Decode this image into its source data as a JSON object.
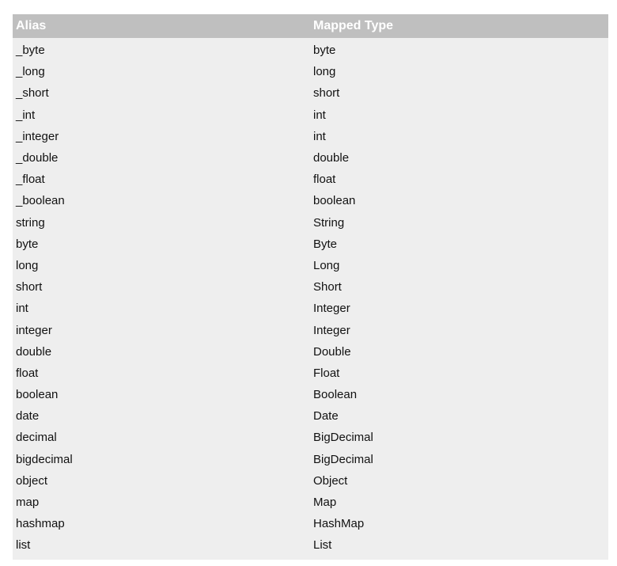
{
  "table": {
    "headers": {
      "alias": "Alias",
      "mapped_type": "Mapped Type"
    },
    "rows": [
      {
        "alias": "_byte",
        "mapped_type": "byte"
      },
      {
        "alias": "_long",
        "mapped_type": "long"
      },
      {
        "alias": "_short",
        "mapped_type": "short"
      },
      {
        "alias": "_int",
        "mapped_type": "int"
      },
      {
        "alias": "_integer",
        "mapped_type": "int"
      },
      {
        "alias": "_double",
        "mapped_type": "double"
      },
      {
        "alias": "_float",
        "mapped_type": "float"
      },
      {
        "alias": "_boolean",
        "mapped_type": "boolean"
      },
      {
        "alias": "string",
        "mapped_type": "String"
      },
      {
        "alias": "byte",
        "mapped_type": "Byte"
      },
      {
        "alias": "long",
        "mapped_type": "Long"
      },
      {
        "alias": "short",
        "mapped_type": "Short"
      },
      {
        "alias": "int",
        "mapped_type": "Integer"
      },
      {
        "alias": "integer",
        "mapped_type": "Integer"
      },
      {
        "alias": "double",
        "mapped_type": "Double"
      },
      {
        "alias": "float",
        "mapped_type": "Float"
      },
      {
        "alias": "boolean",
        "mapped_type": "Boolean"
      },
      {
        "alias": "date",
        "mapped_type": "Date"
      },
      {
        "alias": "decimal",
        "mapped_type": "BigDecimal"
      },
      {
        "alias": "bigdecimal",
        "mapped_type": "BigDecimal"
      },
      {
        "alias": "object",
        "mapped_type": "Object"
      },
      {
        "alias": "map",
        "mapped_type": "Map"
      },
      {
        "alias": "hashmap",
        "mapped_type": "HashMap"
      },
      {
        "alias": "list",
        "mapped_type": "List"
      }
    ]
  }
}
